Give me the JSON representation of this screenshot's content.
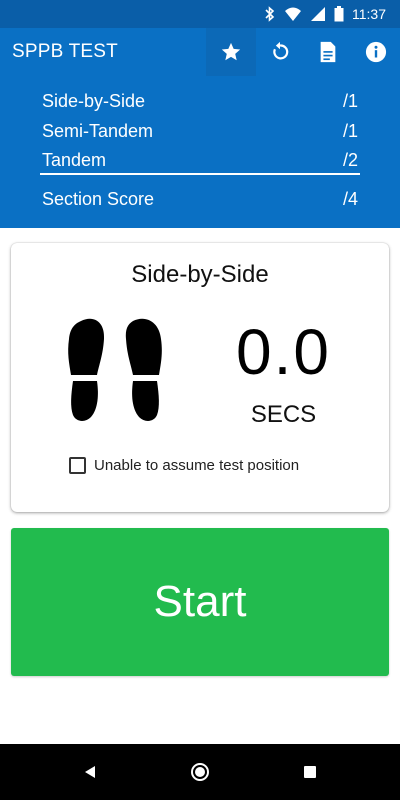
{
  "status_bar": {
    "time": "11:37",
    "icons": [
      "bluetooth-icon",
      "wifi-icon",
      "signal-icon",
      "battery-icon"
    ]
  },
  "app_bar": {
    "title": "SPPB TEST",
    "actions": [
      "star-icon",
      "reset-icon",
      "document-icon",
      "info-icon"
    ]
  },
  "scores": {
    "rows": [
      {
        "label": "Side-by-Side",
        "score": "/1"
      },
      {
        "label": "Semi-Tandem",
        "score": "/1"
      },
      {
        "label": "Tandem",
        "score": "/2"
      }
    ],
    "section": {
      "label": "Section Score",
      "score": "/4"
    }
  },
  "test_card": {
    "title": "Side-by-Side",
    "timer_value": "0.0",
    "timer_unit": "SECS",
    "checkbox_label": "Unable to assume test position",
    "checkbox_checked": false,
    "icon": "footprints-icon"
  },
  "start_button": {
    "label": "Start"
  },
  "nav_bar": {
    "icons": [
      "back-icon",
      "home-icon",
      "recents-icon"
    ]
  },
  "colors": {
    "app_blue": "#0a70c4",
    "status_blue": "#0a5ea8",
    "start_green": "#22bb4e"
  }
}
